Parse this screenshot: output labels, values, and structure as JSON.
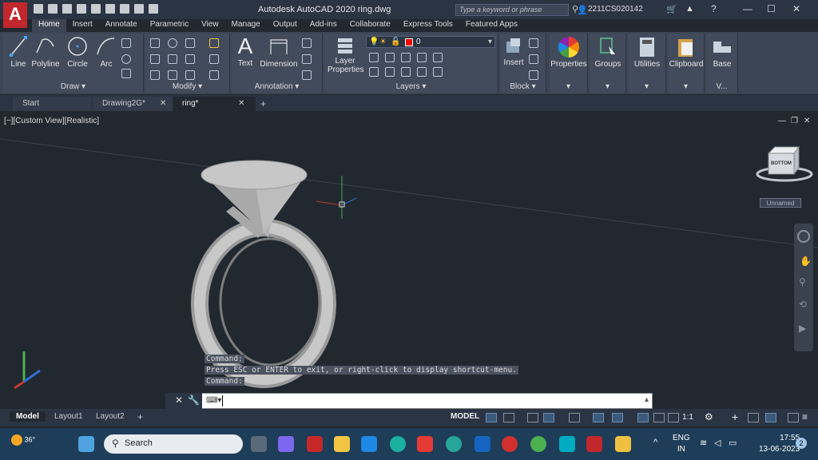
{
  "app": {
    "logo_letter": "A",
    "title": "Autodesk AutoCAD 2020    ring.dwg",
    "search_placeholder": "Type a keyword or phrase",
    "user": "2211CS020142"
  },
  "ribbon_tabs": [
    "Home",
    "Insert",
    "Annotate",
    "Parametric",
    "View",
    "Manage",
    "Output",
    "Add-ins",
    "Collaborate",
    "Express Tools",
    "Featured Apps"
  ],
  "panels": {
    "draw": {
      "title": "Draw ▾",
      "tools": [
        "Line",
        "Polyline",
        "Circle",
        "Arc"
      ]
    },
    "modify": {
      "title": "Modify ▾"
    },
    "annotation": {
      "title": "Annotation ▾",
      "tools": [
        "Text",
        "Dimension"
      ]
    },
    "layers": {
      "title": "Layers ▾",
      "layer_props": "Layer Properties",
      "current_layer": "0"
    },
    "block": {
      "title": "Block ▾",
      "insert": "Insert"
    },
    "properties": {
      "label": "Properties"
    },
    "groups": {
      "label": "Groups"
    },
    "utilities": {
      "label": "Utilities"
    },
    "clipboard": {
      "label": "Clipboard"
    },
    "view": {
      "label": "Base",
      "sub": "V..."
    }
  },
  "doc_tabs": [
    {
      "label": "Start"
    },
    {
      "label": "Drawing2G*"
    },
    {
      "label": "ring*"
    }
  ],
  "viewport": {
    "label": "[−][Custom View][Realistic]",
    "viewcube_face": "BOTTOM",
    "ucs_name": "Unnamed"
  },
  "command_history": [
    "Command:",
    "Press ESC or ENTER to exit, or right-click to display shortcut-menu.",
    "Command:"
  ],
  "layout_tabs": [
    "Model",
    "Layout1",
    "Layout2"
  ],
  "status": {
    "model": "MODEL",
    "scale": "1:1"
  },
  "taskbar": {
    "weather": "36°",
    "search": "Search",
    "lang_top": "ENG",
    "lang_bottom": "IN",
    "time": "17:55",
    "date": "13-06-2023",
    "notifications": "2"
  },
  "colors": {
    "accent": "#c1272d",
    "layer_color": "#ff0000"
  }
}
